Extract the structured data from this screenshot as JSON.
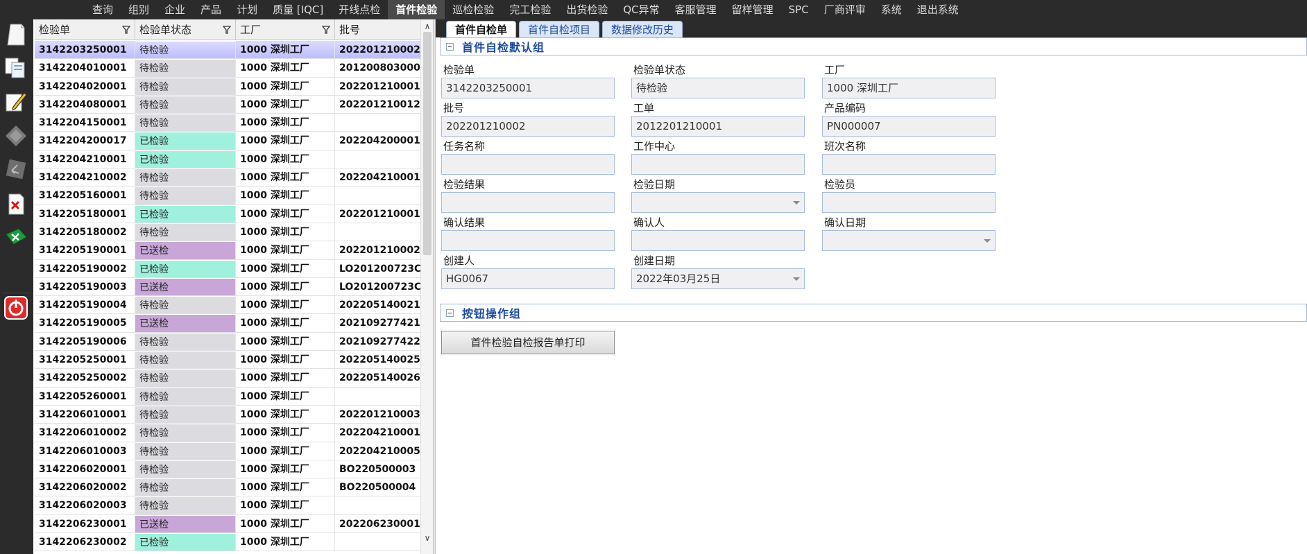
{
  "menu": {
    "items": [
      "查询",
      "组别",
      "企业",
      "产品",
      "计划",
      "质量 [IQC]",
      "开线点检",
      "首件检验",
      "巡检检验",
      "完工检验",
      "出货检验",
      "QC异常",
      "客服管理",
      "留样管理",
      "SPC",
      "厂商评审",
      "系统",
      "退出系统"
    ],
    "active_index": 7
  },
  "toolbar": {
    "icons": [
      "new-document-icon",
      "copy-documents-icon",
      "edit-pencil-icon",
      "diamond-icon",
      "undo-icon",
      "delete-document-icon",
      "export-excel-icon",
      "power-exit-icon"
    ]
  },
  "grid": {
    "columns": [
      "检验单",
      "检验单状态",
      "工厂",
      "批号"
    ],
    "selected_index": 0,
    "rows": [
      {
        "id": "3142203250001",
        "status": "待检验",
        "status_type": "pending",
        "factory": "1000 深圳工厂",
        "batch": "202201210002"
      },
      {
        "id": "3142204010001",
        "status": "待检验",
        "status_type": "pending",
        "factory": "1000 深圳工厂",
        "batch": "201200803000"
      },
      {
        "id": "3142204020001",
        "status": "待检验",
        "status_type": "pending",
        "factory": "1000 深圳工厂",
        "batch": "202201210001"
      },
      {
        "id": "3142204080001",
        "status": "待检验",
        "status_type": "pending",
        "factory": "1000 深圳工厂",
        "batch": "202201210012"
      },
      {
        "id": "3142204150001",
        "status": "待检验",
        "status_type": "pending",
        "factory": "1000 深圳工厂",
        "batch": ""
      },
      {
        "id": "3142204200017",
        "status": "已检验",
        "status_type": "done",
        "factory": "1000 深圳工厂",
        "batch": "202204200001"
      },
      {
        "id": "3142204210001",
        "status": "已检验",
        "status_type": "done",
        "factory": "1000 深圳工厂",
        "batch": ""
      },
      {
        "id": "3142204210002",
        "status": "待检验",
        "status_type": "pending",
        "factory": "1000 深圳工厂",
        "batch": "202204210001"
      },
      {
        "id": "3142205160001",
        "status": "待检验",
        "status_type": "pending",
        "factory": "1000 深圳工厂",
        "batch": ""
      },
      {
        "id": "3142205180001",
        "status": "已检验",
        "status_type": "done",
        "factory": "1000 深圳工厂",
        "batch": "202201210001"
      },
      {
        "id": "3142205180002",
        "status": "待检验",
        "status_type": "pending",
        "factory": "1000 深圳工厂",
        "batch": ""
      },
      {
        "id": "3142205190001",
        "status": "已送检",
        "status_type": "sent",
        "factory": "1000 深圳工厂",
        "batch": "202201210002"
      },
      {
        "id": "3142205190002",
        "status": "已检验",
        "status_type": "done",
        "factory": "1000 深圳工厂",
        "batch": "LO201200723C"
      },
      {
        "id": "3142205190003",
        "status": "已送检",
        "status_type": "sent",
        "factory": "1000 深圳工厂",
        "batch": "LO201200723C"
      },
      {
        "id": "3142205190004",
        "status": "待检验",
        "status_type": "pending",
        "factory": "1000 深圳工厂",
        "batch": "202205140021"
      },
      {
        "id": "3142205190005",
        "status": "已送检",
        "status_type": "sent",
        "factory": "1000 深圳工厂",
        "batch": "202109277421"
      },
      {
        "id": "3142205190006",
        "status": "待检验",
        "status_type": "pending",
        "factory": "1000 深圳工厂",
        "batch": "202109277422"
      },
      {
        "id": "3142205250001",
        "status": "待检验",
        "status_type": "pending",
        "factory": "1000 深圳工厂",
        "batch": "202205140025"
      },
      {
        "id": "3142205250002",
        "status": "待检验",
        "status_type": "pending",
        "factory": "1000 深圳工厂",
        "batch": "202205140026"
      },
      {
        "id": "3142205260001",
        "status": "待检验",
        "status_type": "pending",
        "factory": "1000 深圳工厂",
        "batch": ""
      },
      {
        "id": "3142206010001",
        "status": "待检验",
        "status_type": "pending",
        "factory": "1000 深圳工厂",
        "batch": "202201210003"
      },
      {
        "id": "3142206010002",
        "status": "待检验",
        "status_type": "pending",
        "factory": "1000 深圳工厂",
        "batch": "202204210001"
      },
      {
        "id": "3142206010003",
        "status": "待检验",
        "status_type": "pending",
        "factory": "1000 深圳工厂",
        "batch": "202204210005"
      },
      {
        "id": "3142206020001",
        "status": "待检验",
        "status_type": "pending",
        "factory": "1000 深圳工厂",
        "batch": "BO220500003"
      },
      {
        "id": "3142206020002",
        "status": "待检验",
        "status_type": "pending",
        "factory": "1000 深圳工厂",
        "batch": "BO220500004"
      },
      {
        "id": "3142206020003",
        "status": "待检验",
        "status_type": "pending",
        "factory": "1000 深圳工厂",
        "batch": ""
      },
      {
        "id": "3142206230001",
        "status": "已送检",
        "status_type": "sent",
        "factory": "1000 深圳工厂",
        "batch": "202206230001"
      },
      {
        "id": "3142206230002",
        "status": "已检验",
        "status_type": "done",
        "factory": "1000 深圳工厂",
        "batch": ""
      }
    ]
  },
  "tabs": {
    "items": [
      "首件自检单",
      "首件自检项目",
      "数据修改历史"
    ],
    "active_index": 0
  },
  "form": {
    "group_title": "首件自检默认组",
    "fields": {
      "inspection_no": {
        "label": "检验单",
        "value": "3142203250001"
      },
      "status": {
        "label": "检验单状态",
        "value": "待检验"
      },
      "factory": {
        "label": "工厂",
        "value": "1000 深圳工厂"
      },
      "batch": {
        "label": "批号",
        "value": "202201210002"
      },
      "work_order": {
        "label": "工单",
        "value": "2012201210001"
      },
      "product_code": {
        "label": "产品编码",
        "value": "PN000007"
      },
      "task_name": {
        "label": "任务名称",
        "value": ""
      },
      "work_center": {
        "label": "工作中心",
        "value": ""
      },
      "shift_name": {
        "label": "班次名称",
        "value": ""
      },
      "result": {
        "label": "检验结果",
        "value": ""
      },
      "inspect_date": {
        "label": "检验日期",
        "value": ""
      },
      "inspector": {
        "label": "检验员",
        "value": ""
      },
      "confirm_result": {
        "label": "确认结果",
        "value": ""
      },
      "confirmer": {
        "label": "确认人",
        "value": ""
      },
      "confirm_date": {
        "label": "确认日期",
        "value": ""
      },
      "creator": {
        "label": "创建人",
        "value": "HG0067"
      },
      "create_date": {
        "label": "创建日期",
        "value": "2022年03月25日"
      }
    }
  },
  "buttons_group": {
    "title": "按钮操作组",
    "print_label": "首件检验自检报告单打印"
  },
  "colors": {
    "status_pending": "#dcdce0",
    "status_done": "#9ff0dc",
    "status_sent": "#c8a6d8",
    "tab_text": "#1a4aa0"
  }
}
